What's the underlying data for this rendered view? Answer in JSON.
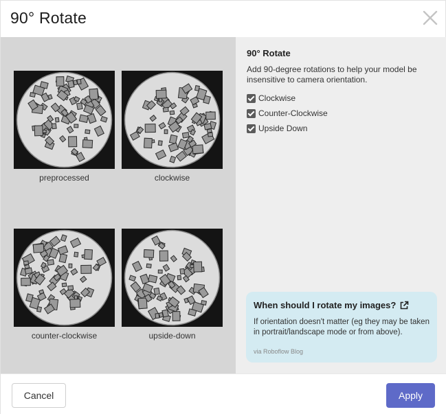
{
  "dialog": {
    "title": "90° Rotate",
    "close_icon": "close-icon"
  },
  "preview": {
    "items": [
      {
        "caption": "preprocessed",
        "rotation": 0
      },
      {
        "caption": "clockwise",
        "rotation": 90
      },
      {
        "caption": "counter-clockwise",
        "rotation": -90
      },
      {
        "caption": "upside-down",
        "rotation": 180
      }
    ]
  },
  "settings": {
    "title": "90° Rotate",
    "description": "Add 90-degree rotations to help your model be insensitive to camera orientation.",
    "options": [
      {
        "label": "Clockwise",
        "checked": true
      },
      {
        "label": "Counter-Clockwise",
        "checked": true
      },
      {
        "label": "Upside Down",
        "checked": true
      }
    ]
  },
  "info_card": {
    "title": "When should I rotate my images?",
    "link_icon": "external-link-icon",
    "body": "If orientation doesn't matter (eg they may be taken in portrait/landscape mode or from above).",
    "source": "via Roboflow Blog"
  },
  "footer": {
    "cancel_label": "Cancel",
    "apply_label": "Apply"
  },
  "colors": {
    "preview_bg": "#d6d6d6",
    "settings_bg": "#eeeeee",
    "info_bg": "#d4ebf2",
    "apply_bg": "#5e6ac8"
  }
}
